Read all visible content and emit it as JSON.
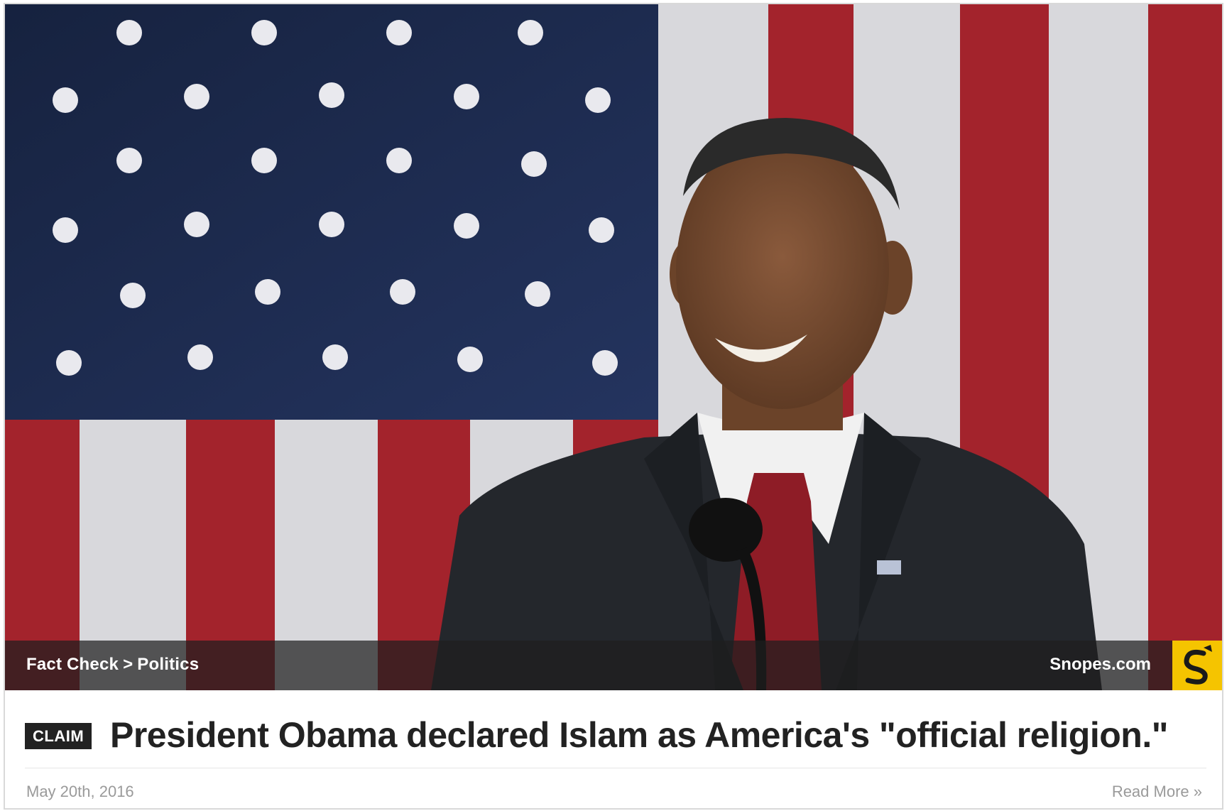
{
  "hero": {
    "breadcrumb": [
      "Fact Check",
      "Politics"
    ],
    "breadcrumb_separator": ">",
    "site_name": "Snopes.com",
    "logo_icon": "snopes-s-logo-icon",
    "logo_bg": "#f5c400"
  },
  "claim": {
    "badge": "CLAIM",
    "title": "President Obama declared Islam as America's \"official religion.\""
  },
  "meta": {
    "date": "May 20th, 2016",
    "read_more": "Read More »"
  },
  "colors": {
    "flag_blue": "#1c2a52",
    "flag_red": "#a3232c",
    "flag_white": "#d8d8dc",
    "suit": "#24272c",
    "tie": "#8e1c26"
  }
}
